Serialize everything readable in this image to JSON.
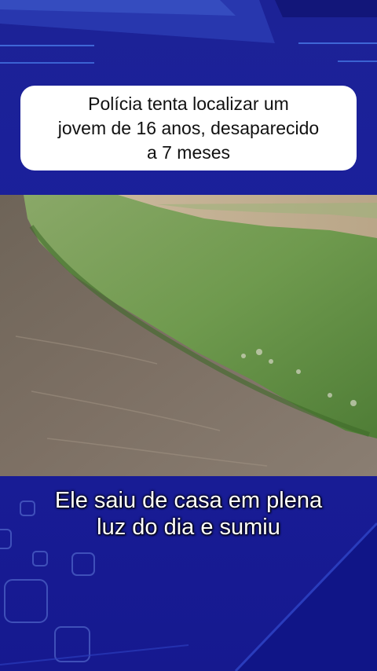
{
  "headline": {
    "line1": "Polícia tenta localizar um",
    "line2": "jovem de 16 anos, desaparecido",
    "line3": "a 7 meses"
  },
  "subtitle": {
    "line1": "Ele saiu de casa em plena",
    "line2": "luz do dia e sumiu"
  },
  "colors": {
    "background": "#1a1f9a",
    "card": "#ffffff",
    "subtitle_text": "#ffffff"
  }
}
